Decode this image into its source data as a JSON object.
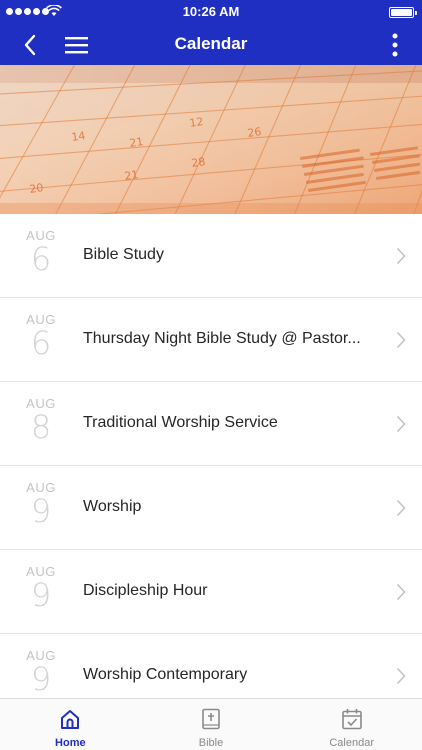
{
  "status_bar": {
    "time": "10:26 AM"
  },
  "nav": {
    "title": "Calendar"
  },
  "events": [
    {
      "month": "AUG",
      "day": "6",
      "title": "Bible Study"
    },
    {
      "month": "AUG",
      "day": "6",
      "title": "Thursday Night Bible Study @ Pastor..."
    },
    {
      "month": "AUG",
      "day": "8",
      "title": "Traditional Worship Service"
    },
    {
      "month": "AUG",
      "day": "9",
      "title": "Worship"
    },
    {
      "month": "AUG",
      "day": "9",
      "title": "Discipleship Hour"
    },
    {
      "month": "AUG",
      "day": "9",
      "title": "Worship Contemporary"
    }
  ],
  "tabs": [
    {
      "label": "Home",
      "icon": "home-icon",
      "active": true
    },
    {
      "label": "Bible",
      "icon": "bible-icon",
      "active": false
    },
    {
      "label": "Calendar",
      "icon": "calendar-check-icon",
      "active": false
    }
  ],
  "colors": {
    "primary": "#1f2fc2",
    "banner_tint": "#ee9a5f"
  }
}
